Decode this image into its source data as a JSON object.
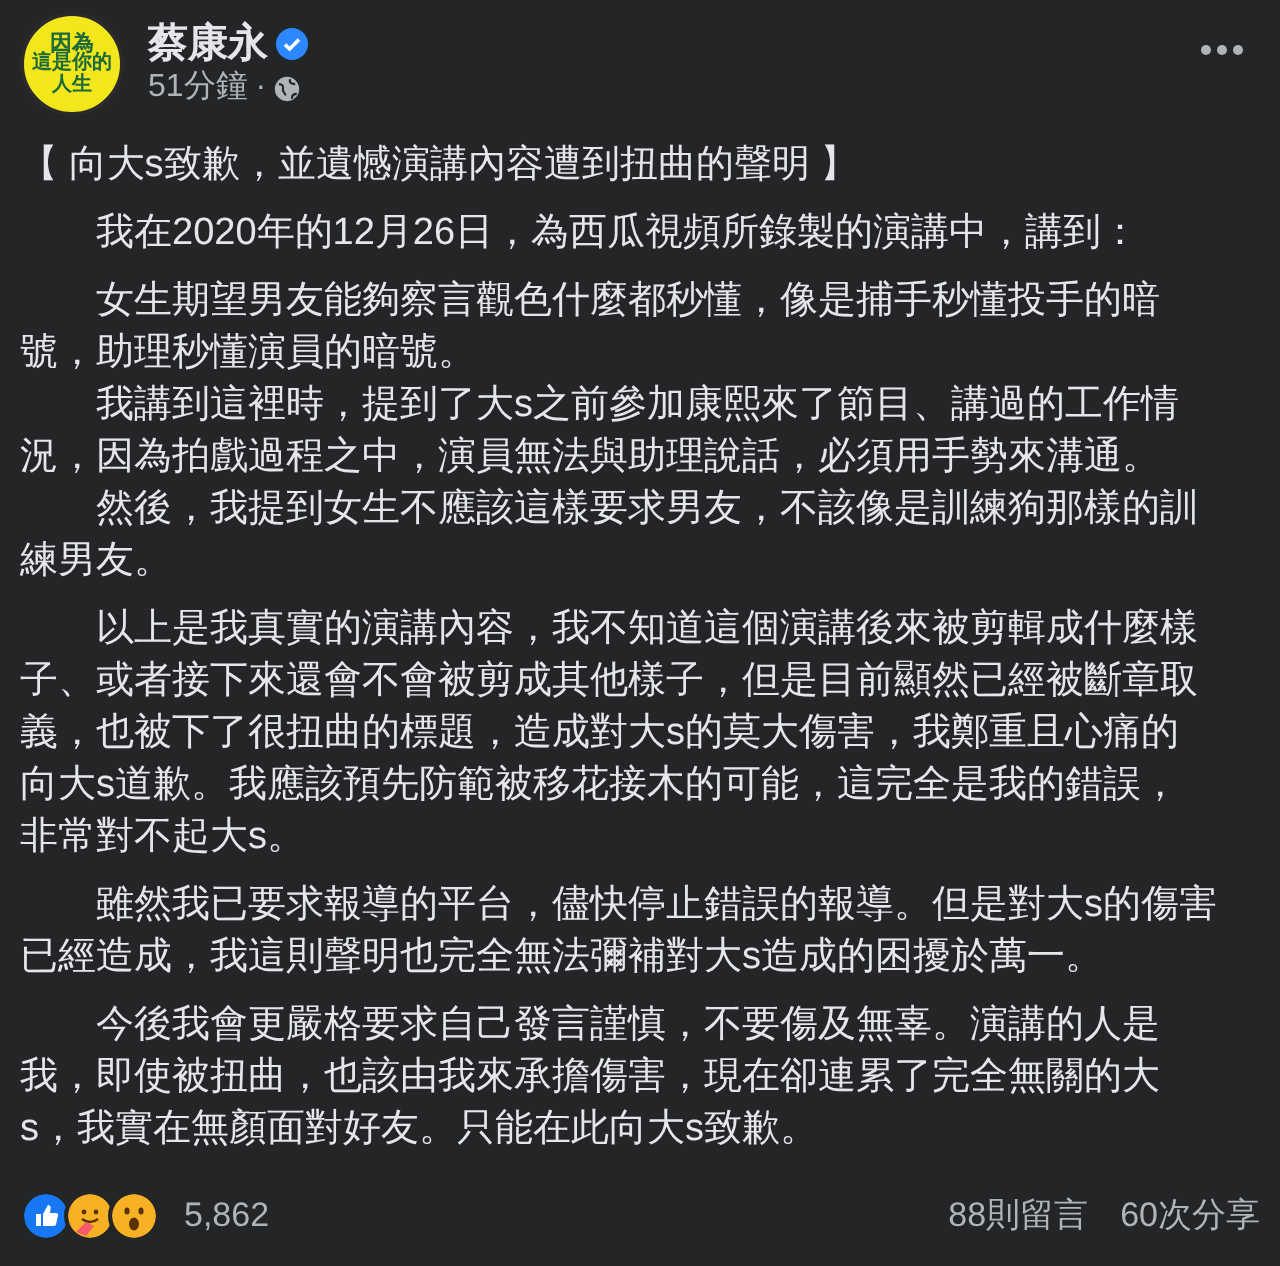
{
  "post": {
    "avatar": {
      "lines": [
        "因為",
        "這是你的",
        "人生"
      ]
    },
    "author": "蔡康永",
    "verified": true,
    "time": "51分鐘",
    "separator": "·",
    "title": "【 向大s致歉，並遺憾演講內容遭到扭曲的聲明 】",
    "sections": [
      {
        "paragraphs": [
          {
            "lines": [
              "我在2020年的12月26日，為西瓜視頻所錄製的演講中，講到："
            ]
          }
        ]
      },
      {
        "paragraphs": [
          {
            "lines": [
              "女生期望男友能夠察言觀色什麼都秒懂，像是捕手秒懂投手的暗",
              "號，助理秒懂演員的暗號。"
            ]
          },
          {
            "lines": [
              "我講到這裡時，提到了大s之前參加康熙來了節目、講過的工作情",
              "況，因為拍戲過程之中，演員無法與助理說話，必須用手勢來溝通。"
            ]
          },
          {
            "lines": [
              "然後，我提到女生不應該這樣要求男友，不該像是訓練狗那樣的訓",
              "練男友。"
            ]
          }
        ]
      },
      {
        "paragraphs": [
          {
            "lines": [
              "以上是我真實的演講內容，我不知道這個演講後來被剪輯成什麼樣",
              "子、或者接下來還會不會被剪成其他樣子，但是目前顯然已經被斷章取",
              "義，也被下了很扭曲的標題，造成對大s的莫大傷害，我鄭重且心痛的",
              "向大s道歉。我應該預先防範被移花接木的可能，這完全是我的錯誤，",
              "非常對不起大s。"
            ]
          }
        ]
      },
      {
        "paragraphs": [
          {
            "lines": [
              "雖然我已要求報導的平台，儘快停止錯誤的報導。但是對大s的傷害",
              "已經造成，我這則聲明也完全無法彌補對大s造成的困擾於萬一。"
            ]
          }
        ]
      },
      {
        "paragraphs": [
          {
            "lines": [
              "今後我會更嚴格要求自己發言謹慎，不要傷及無辜。演講的人是",
              "我，即使被扭曲，也該由我來承擔傷害，現在卻連累了完全無關的大",
              "s，我實在無顏面對好友。只能在此向大s致歉。"
            ]
          }
        ]
      }
    ],
    "reactions": {
      "icons": [
        {
          "kind": "like"
        },
        {
          "kind": "care"
        },
        {
          "kind": "wow"
        }
      ],
      "count": "5,862"
    },
    "comments": "88則留言",
    "shares": "60次分享"
  }
}
